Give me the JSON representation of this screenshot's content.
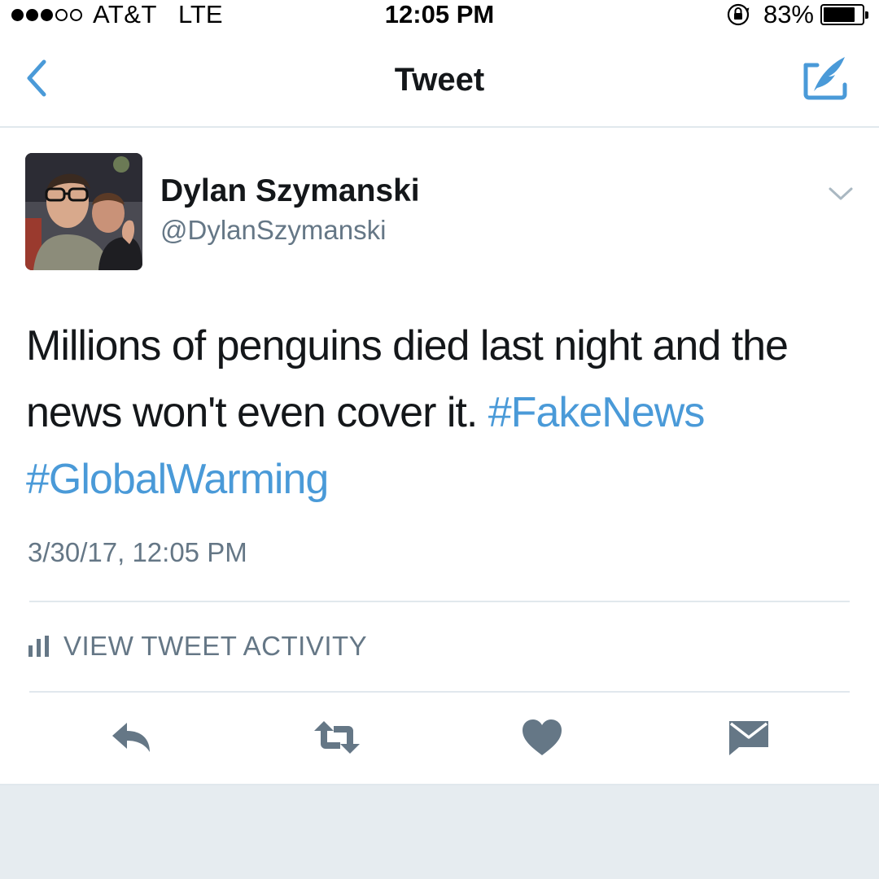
{
  "status_bar": {
    "signal_dots": [
      "full",
      "full",
      "full",
      "empty",
      "empty"
    ],
    "carrier": "AT&T",
    "network": "LTE",
    "time": "12:05 PM",
    "battery_percent_label": "83%",
    "battery_level": 0.83
  },
  "nav": {
    "title": "Tweet",
    "back_icon": "chevron-left-icon",
    "compose_icon": "compose-icon"
  },
  "tweet": {
    "display_name": "Dylan Szymanski",
    "handle": "@DylanSzymanski",
    "text_plain": "Millions of penguins died last night and the news won't even cover it.",
    "hashtags": [
      "#FakeNews",
      "#GlobalWarming"
    ],
    "timestamp": "3/30/17, 12:05 PM"
  },
  "activity": {
    "label": "VIEW TWEET ACTIVITY",
    "icon": "bar-chart-icon"
  },
  "actions": [
    "reply-icon",
    "retweet-icon",
    "like-icon",
    "direct-message-icon"
  ],
  "colors": {
    "accent": "#4a9ad8",
    "text_primary": "#14171a",
    "text_secondary": "#657786",
    "icon_gray": "#657786",
    "divider": "#e1e8ed",
    "footer_bg": "#e6ecf0"
  }
}
